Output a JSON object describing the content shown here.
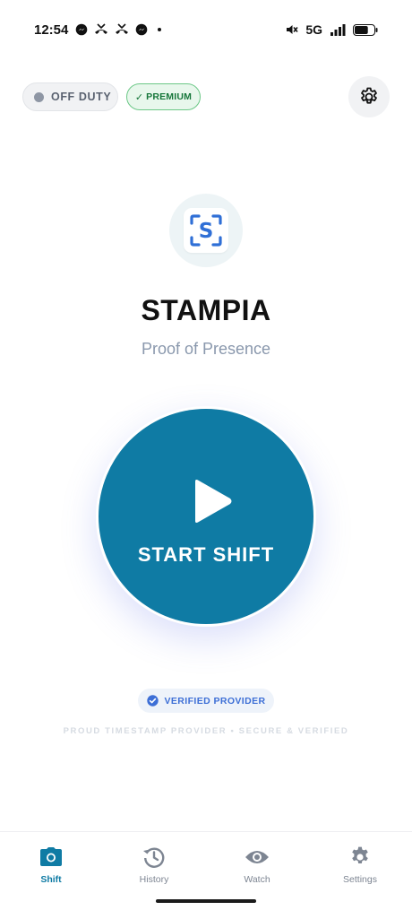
{
  "status_bar": {
    "time": "12:54",
    "network": "5G",
    "battery_level": 0.7
  },
  "header": {
    "status_chip": {
      "label": "OFF DUTY",
      "dot_color": "#8e96a4"
    },
    "premium_chip": {
      "check": "✓",
      "label": "PREMIUM"
    },
    "settings_icon": "gear-icon"
  },
  "brand": {
    "logo_letter": "S",
    "title": "STAMPIA",
    "subtitle": "Proof of Presence"
  },
  "start_button": {
    "label": "START SHIFT",
    "color": "#0f7ba4"
  },
  "verified_badge": {
    "label": "VERIFIED PROVIDER"
  },
  "tagline": "PROUD TIMESTAMP PROVIDER • SECURE & VERIFIED",
  "nav": {
    "items": [
      {
        "label": "Shift",
        "icon": "camera-icon",
        "active": true
      },
      {
        "label": "History",
        "icon": "history-icon",
        "active": false
      },
      {
        "label": "Watch",
        "icon": "eye-icon",
        "active": false
      },
      {
        "label": "Settings",
        "icon": "gear-icon",
        "active": false
      }
    ]
  },
  "colors": {
    "accent": "#0f7ba4",
    "premium_green": "#16763a",
    "verified_blue": "#3d6fd6"
  }
}
